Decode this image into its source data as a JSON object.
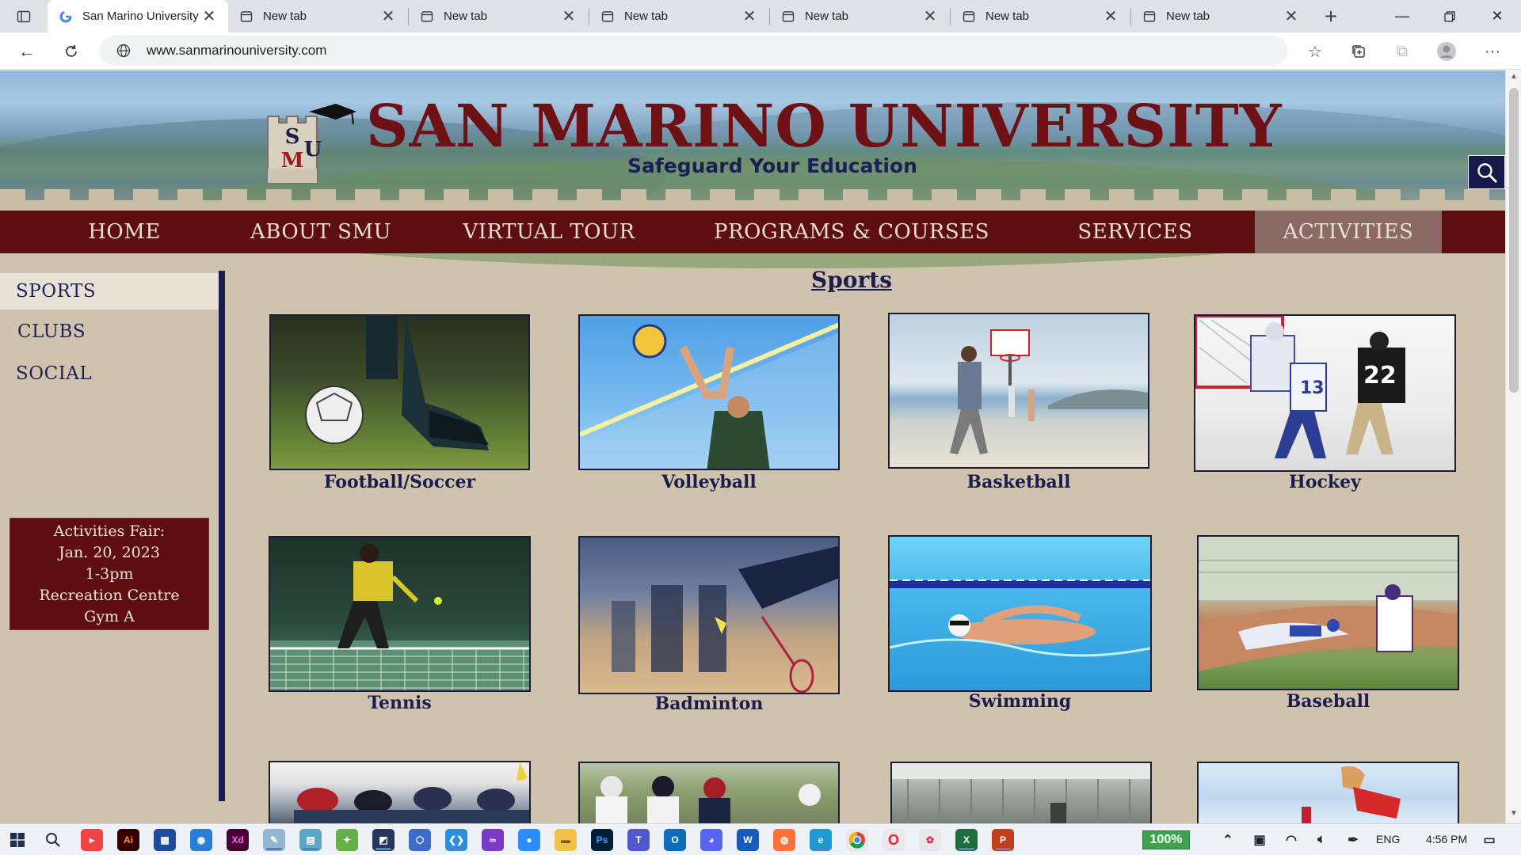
{
  "browser": {
    "tabs": [
      {
        "title": "San Marino University",
        "active": true
      },
      {
        "title": "New tab",
        "active": false
      },
      {
        "title": "New tab",
        "active": false
      },
      {
        "title": "New tab",
        "active": false
      },
      {
        "title": "New tab",
        "active": false
      },
      {
        "title": "New tab",
        "active": false
      },
      {
        "title": "New tab",
        "active": false
      }
    ],
    "address": "www.sanmarinouniversity.com"
  },
  "site": {
    "title": "SAN MARINO UNIVERSITY",
    "tagline": "Safeguard Your Education",
    "logo_letters": "SMU",
    "nav": [
      "HOME",
      "ABOUT SMU",
      "VIRTUAL TOUR",
      "PROGRAMS & COURSES",
      "SERVICES",
      "ACTIVITIES"
    ],
    "active_nav": "ACTIVITIES"
  },
  "sidebar": {
    "items": [
      "SPORTS",
      "CLUBS",
      "SOCIAL"
    ],
    "active": "SPORTS",
    "event": {
      "line1": "Activities Fair:",
      "line2": "Jan. 20, 2023",
      "line3": "1-3pm",
      "line4": "Recreation Centre",
      "line5": "Gym A"
    }
  },
  "main": {
    "section_title": "Sports",
    "sports": [
      {
        "label": "Football/Soccer"
      },
      {
        "label": "Volleyball"
      },
      {
        "label": "Basketball"
      },
      {
        "label": "Hockey"
      },
      {
        "label": "Tennis"
      },
      {
        "label": "Badminton"
      },
      {
        "label": "Swimming"
      },
      {
        "label": "Baseball"
      },
      {
        "label": ""
      },
      {
        "label": ""
      },
      {
        "label": ""
      },
      {
        "label": ""
      }
    ]
  },
  "taskbar": {
    "zoom": "100%",
    "language": "ENG",
    "time": "4:56 PM"
  },
  "colors": {
    "brand_maroon": "#5e0d10",
    "brand_navy": "#1b1d4f",
    "page_bg": "#cfc3ad"
  }
}
